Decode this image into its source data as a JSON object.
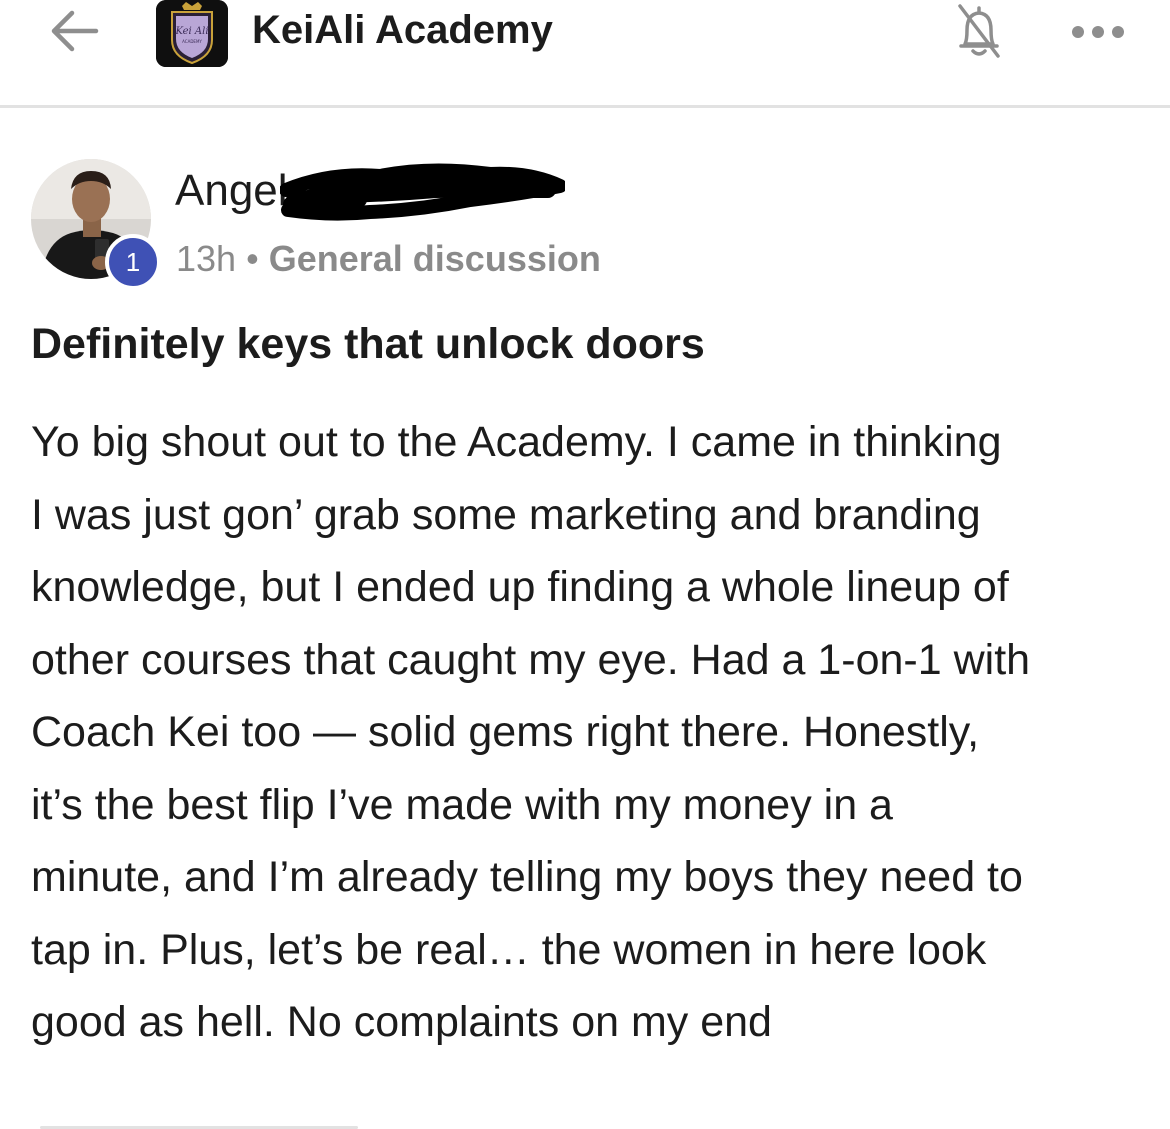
{
  "header": {
    "back_icon": "arrow-left-icon",
    "logo_text": "Kei Ali",
    "logo_subtext": "ACADEMY",
    "group_title": "KeiAli Academy",
    "bell_icon": "bell-off-icon",
    "more_icon": "more-horizontal-icon"
  },
  "post": {
    "author_name": "Angel",
    "author_level": "1",
    "time": "13h",
    "separator": "•",
    "category": "General discussion",
    "title": "Definitely keys that unlock doors",
    "body_lines": [
      "Yo big shout out to the Academy. I came in thinking",
      "I was just gon’ grab some marketing and branding",
      "knowledge, but I ended up finding a whole lineup of",
      "other courses that caught my eye. Had a 1-on-1 with",
      "Coach Kei too — solid gems right there. Honestly,",
      "it’s the best flip I’ve made with my money in a",
      "minute, and I’m already telling my boys they need to",
      "tap in. Plus, let’s be real… the women in here look",
      "good as hell. No complaints on my end"
    ]
  },
  "colors": {
    "text": "#1c1c1c",
    "muted": "#8a8a8a",
    "badge": "#3f51b5",
    "divider": "#e2e2e2"
  }
}
